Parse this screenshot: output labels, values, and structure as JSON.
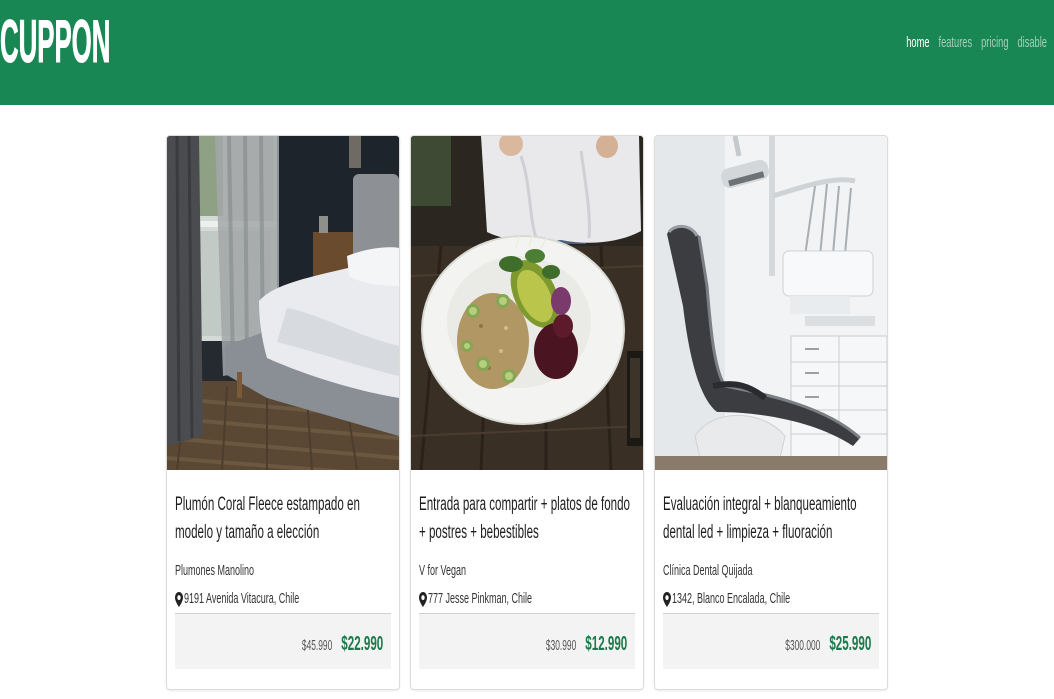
{
  "header": {
    "logo": "CUPPON",
    "nav": [
      {
        "label": "home",
        "active": true
      },
      {
        "label": "features",
        "active": false
      },
      {
        "label": "pricing",
        "active": false
      },
      {
        "label": "disable",
        "active": false
      }
    ]
  },
  "colors": {
    "brand": "#198754",
    "price": "#1b7a4b",
    "nav_active": "#ffffff",
    "nav_inactive": "#a3d0b9"
  },
  "location_icon": "map-marker-icon",
  "cards": [
    {
      "title": "Plumón Coral Fleece estampado en modelo y tamaño a elección",
      "vendor": "Plumones Manolino",
      "location": "9191 Avenida Vitacura, Chile",
      "old_price": "$45.990",
      "price": "$22.990"
    },
    {
      "title": "Entrada para compartir + platos de fondo + postres + bebestibles",
      "vendor": "V for Vegan",
      "location": "777 Jesse Pinkman, Chile",
      "old_price": "$30.990",
      "price": "$12.990"
    },
    {
      "title": "Evaluación integral + blanqueamiento dental led + limpieza + fluoración",
      "vendor": "Clínica Dental Quijada",
      "location": "1342, Blanco Encalada, Chile",
      "old_price": "$300.000",
      "price": "$25.990"
    }
  ]
}
